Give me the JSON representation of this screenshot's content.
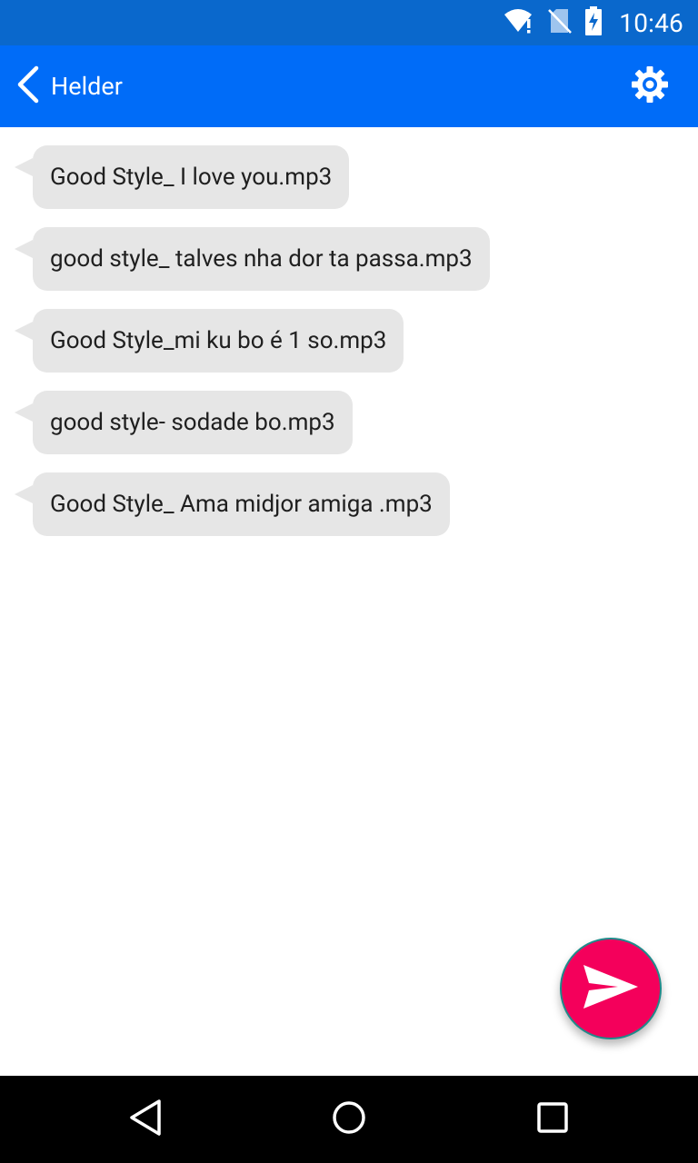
{
  "status_bar": {
    "time": "10:46",
    "icons": [
      "wifi-alert-icon",
      "no-sim-icon",
      "battery-charging-icon"
    ]
  },
  "header": {
    "title": "Helder",
    "back_icon": "chevron-left-icon",
    "settings_icon": "gear-icon"
  },
  "messages": [
    {
      "text": "Good Style_ I love you.mp3"
    },
    {
      "text": "good style_ talves nha dor ta passa.mp3"
    },
    {
      "text": "Good Style_mi ku bo é 1 so.mp3"
    },
    {
      "text": "good style- sodade bo.mp3"
    },
    {
      "text": "Good Style_ Ama midjor amiga .mp3"
    }
  ],
  "fab": {
    "icon": "send-icon"
  },
  "nav_bar": {
    "icons": [
      "back-triangle-icon",
      "home-circle-icon",
      "recents-square-icon"
    ]
  },
  "colors": {
    "status_bar": "#0a68cc",
    "app_bar": "#006cf8",
    "bubble": "#e6e6e6",
    "fab": "#f4005b"
  }
}
